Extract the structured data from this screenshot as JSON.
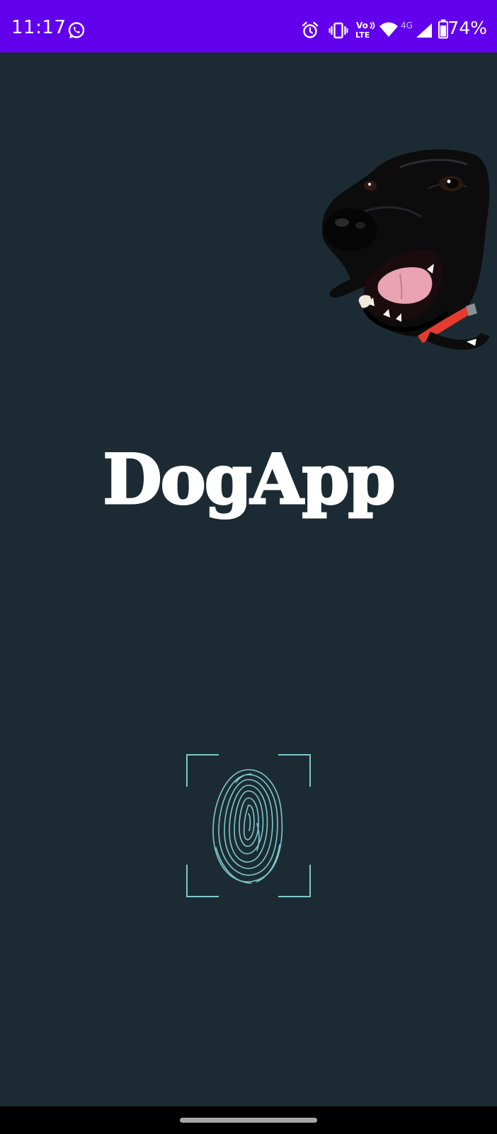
{
  "status_bar": {
    "time": "11:17",
    "network_top": "Vo",
    "network_bottom": "LTE",
    "signal_type": "4G",
    "battery_percent": "74%",
    "background_color": "#6200ee",
    "icons": [
      "whatsapp-icon",
      "alarm-icon",
      "vibrate-icon",
      "volte-icon",
      "wifi-icon",
      "cell-signal-icon",
      "battery-icon"
    ]
  },
  "main": {
    "app_title": "DogApp",
    "background_color": "#1c2b33",
    "accent_color": "#7ec8cc",
    "hero_image": "dog-image",
    "auth_icon": "fingerprint-icon"
  },
  "nav_bar": {
    "handle": "home-handle"
  }
}
